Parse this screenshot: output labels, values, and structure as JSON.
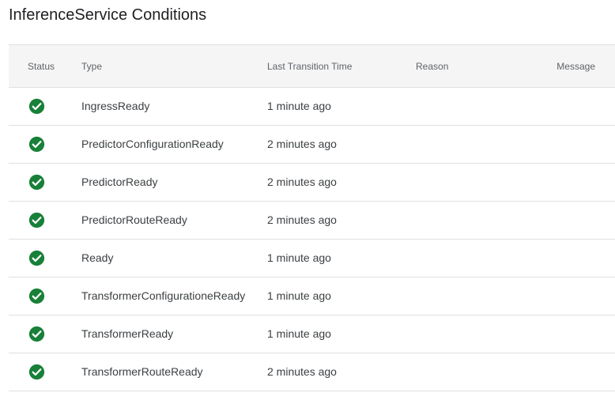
{
  "title": "InferenceService Conditions",
  "columns": {
    "status": "Status",
    "type": "Type",
    "last_transition_time": "Last Transition Time",
    "reason": "Reason",
    "message": "Message"
  },
  "colors": {
    "success": "#188038",
    "header_bg": "#f5f5f5",
    "border": "#e0e0e0"
  },
  "rows": [
    {
      "status_icon": "check-circle-icon",
      "type": "IngressReady",
      "time": "1 minute ago",
      "reason": "",
      "message": ""
    },
    {
      "status_icon": "check-circle-icon",
      "type": "PredictorConfigurationReady",
      "time": "2 minutes ago",
      "reason": "",
      "message": ""
    },
    {
      "status_icon": "check-circle-icon",
      "type": "PredictorReady",
      "time": "2 minutes ago",
      "reason": "",
      "message": ""
    },
    {
      "status_icon": "check-circle-icon",
      "type": "PredictorRouteReady",
      "time": "2 minutes ago",
      "reason": "",
      "message": ""
    },
    {
      "status_icon": "check-circle-icon",
      "type": "Ready",
      "time": "1 minute ago",
      "reason": "",
      "message": ""
    },
    {
      "status_icon": "check-circle-icon",
      "type": "TransformerConfigurationeReady",
      "time": "1 minute ago",
      "reason": "",
      "message": ""
    },
    {
      "status_icon": "check-circle-icon",
      "type": "TransformerReady",
      "time": "1 minute ago",
      "reason": "",
      "message": ""
    },
    {
      "status_icon": "check-circle-icon",
      "type": "TransformerRouteReady",
      "time": "2 minutes ago",
      "reason": "",
      "message": ""
    }
  ]
}
